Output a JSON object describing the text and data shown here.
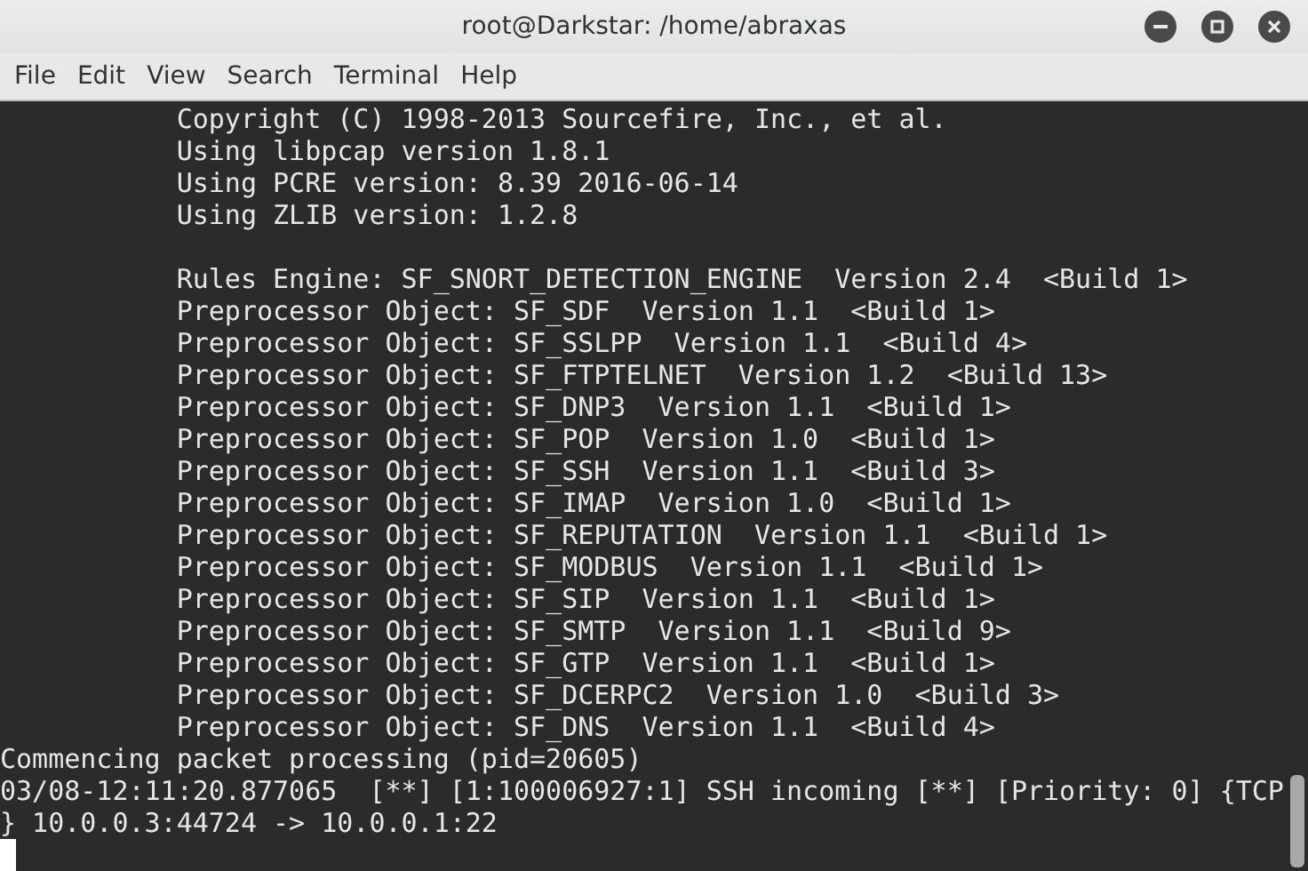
{
  "window": {
    "title": "root@Darkstar: /home/abraxas"
  },
  "menu": [
    "File",
    "Edit",
    "View",
    "Search",
    "Terminal",
    "Help"
  ],
  "terminal": {
    "blocks": [
      [
        "           Copyright (C) 1998-2013 Sourcefire, Inc., et al.",
        "           Using libpcap version 1.8.1",
        "           Using PCRE version: 8.39 2016-06-14",
        "           Using ZLIB version: 1.2.8"
      ],
      [
        "           Rules Engine: SF_SNORT_DETECTION_ENGINE  Version 2.4  <Build 1>",
        "           Preprocessor Object: SF_SDF  Version 1.1  <Build 1>",
        "           Preprocessor Object: SF_SSLPP  Version 1.1  <Build 4>",
        "           Preprocessor Object: SF_FTPTELNET  Version 1.2  <Build 13>",
        "           Preprocessor Object: SF_DNP3  Version 1.1  <Build 1>",
        "           Preprocessor Object: SF_POP  Version 1.0  <Build 1>",
        "           Preprocessor Object: SF_SSH  Version 1.1  <Build 3>",
        "           Preprocessor Object: SF_IMAP  Version 1.0  <Build 1>",
        "           Preprocessor Object: SF_REPUTATION  Version 1.1  <Build 1>",
        "           Preprocessor Object: SF_MODBUS  Version 1.1  <Build 1>",
        "           Preprocessor Object: SF_SIP  Version 1.1  <Build 1>",
        "           Preprocessor Object: SF_SMTP  Version 1.1  <Build 9>",
        "           Preprocessor Object: SF_GTP  Version 1.1  <Build 1>",
        "           Preprocessor Object: SF_DCERPC2  Version 1.0  <Build 3>",
        "           Preprocessor Object: SF_DNS  Version 1.1  <Build 4>",
        "Commencing packet processing (pid=20605)",
        "03/08-12:11:20.877065  [**] [1:100006927:1] SSH incoming [**] [Priority: 0] {TCP",
        "} 10.0.0.3:44724 -> 10.0.0.1:22"
      ]
    ]
  }
}
